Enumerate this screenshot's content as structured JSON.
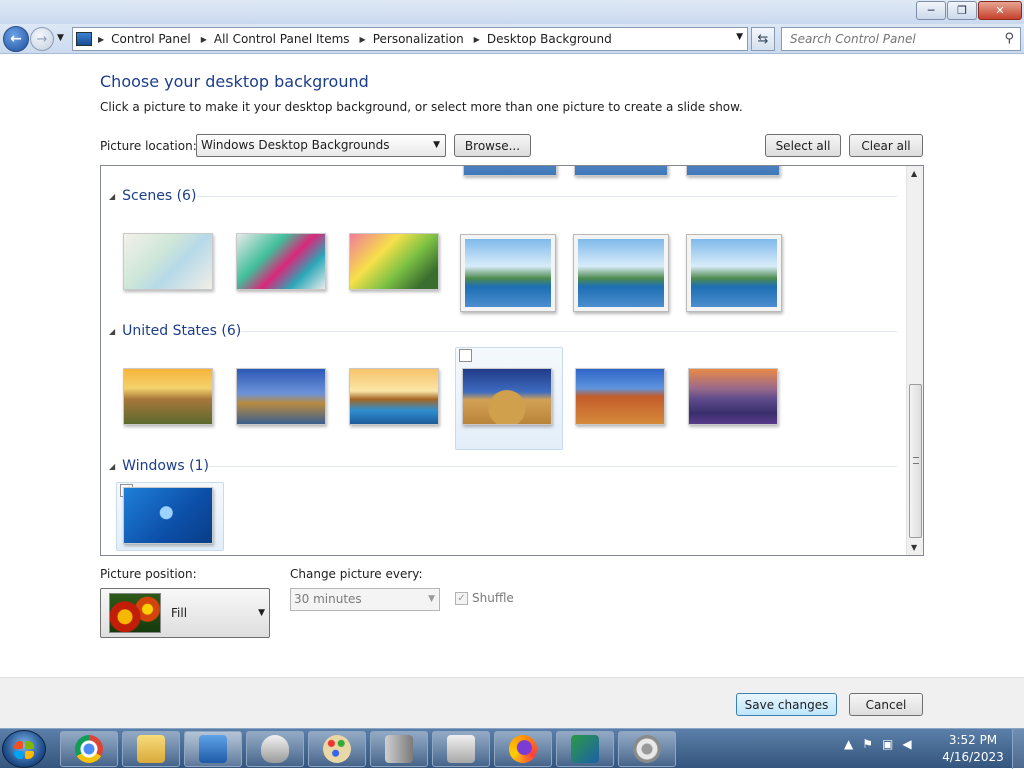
{
  "window": {
    "min": "─",
    "max": "❐",
    "close": "✕"
  },
  "nav": {
    "back_icon": "back-arrow-icon",
    "forward_icon": "forward-arrow-icon",
    "breadcrumbs": [
      "Control Panel",
      "All Control Panel Items",
      "Personalization",
      "Desktop Background"
    ],
    "search_placeholder": "Search Control Panel"
  },
  "main": {
    "title": "Choose your desktop background",
    "description": "Click a picture to make it your desktop background, or select more than one picture to create a slide show.",
    "picture_location_label": "Picture location:",
    "picture_location_value": "Windows Desktop Backgrounds",
    "browse": "Browse...",
    "select_all": "Select all",
    "clear_all": "Clear all"
  },
  "gallery": {
    "groups": [
      {
        "name": "Scenes (6)",
        "count": 6
      },
      {
        "name": "United States (6)",
        "count": 6
      },
      {
        "name": "Windows (1)",
        "count": 1
      }
    ],
    "selected": {
      "group": "Windows (1)",
      "index": 0,
      "checked": true
    },
    "hovered": {
      "group": "United States (6)",
      "index": 3,
      "checked": false
    },
    "scroll_fraction": 0.94
  },
  "options": {
    "position_label": "Picture position:",
    "position_value": "Fill",
    "change_label": "Change picture every:",
    "change_value": "30 minutes",
    "shuffle_label": "Shuffle",
    "shuffle_checked": true
  },
  "footer": {
    "save": "Save changes",
    "cancel": "Cancel"
  },
  "taskbar": {
    "apps": [
      "chrome-icon",
      "file-explorer-icon",
      "control-panel-icon",
      "mouse-icon",
      "paint-icon",
      "server-icon",
      "printer-icon",
      "firefox-icon",
      "display-icon",
      "speaker-icon"
    ],
    "time": "3:52 PM",
    "date": "4/16/2023"
  }
}
